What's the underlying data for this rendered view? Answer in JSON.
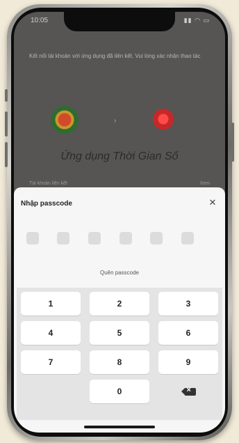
{
  "status": {
    "time": "10:05",
    "icons": "▮▮ ◠ ▭"
  },
  "background": {
    "consent_text": "Kết nối tài khoản với ứng dụng đã liên kết. Vui lòng xác nhận thao tác",
    "app_title": "Ứng dụng Thời Gian Số",
    "row_left": "Tài khoản liên kết",
    "row_right": "Xem"
  },
  "sheet": {
    "title": "Nhập passcode",
    "close_icon": "close-icon",
    "code_length": 6,
    "forgot_label": "Quên passcode"
  },
  "keypad": {
    "keys": [
      "1",
      "2",
      "3",
      "4",
      "5",
      "6",
      "7",
      "8",
      "9",
      "",
      "0",
      "delete"
    ]
  },
  "colors": {
    "sheet": "#f6f6f6",
    "key": "#ffffff",
    "overlay": "#565553"
  }
}
